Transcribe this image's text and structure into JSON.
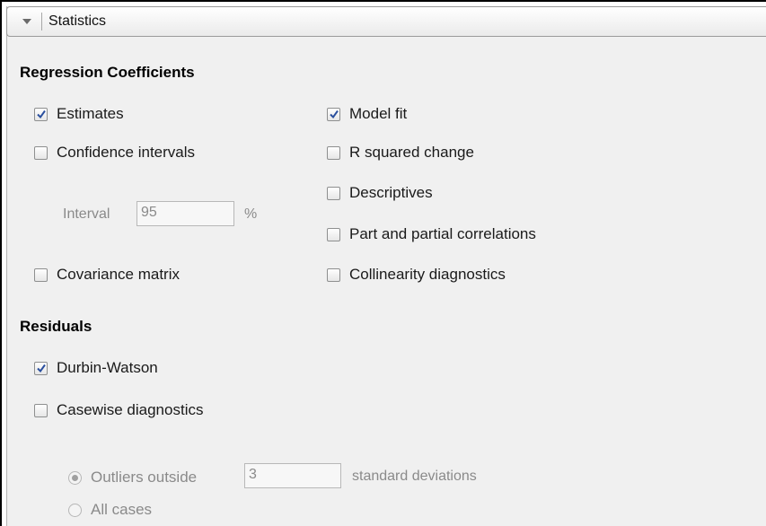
{
  "header": {
    "title": "Statistics"
  },
  "regression": {
    "title": "Regression Coefficients",
    "estimates": {
      "label": "Estimates",
      "checked": true
    },
    "confidence_intervals": {
      "label": "Confidence intervals",
      "checked": false
    },
    "interval": {
      "label": "Interval",
      "value": "95",
      "unit": "%"
    },
    "covariance_matrix": {
      "label": "Covariance matrix",
      "checked": false
    },
    "model_fit": {
      "label": "Model fit",
      "checked": true
    },
    "r_squared_change": {
      "label": "R squared change",
      "checked": false
    },
    "descriptives": {
      "label": "Descriptives",
      "checked": false
    },
    "part_partial": {
      "label": "Part and partial correlations",
      "checked": false
    },
    "collinearity": {
      "label": "Collinearity diagnostics",
      "checked": false
    }
  },
  "residuals": {
    "title": "Residuals",
    "durbin_watson": {
      "label": "Durbin-Watson",
      "checked": true
    },
    "casewise": {
      "label": "Casewise diagnostics",
      "checked": false
    },
    "outliers": {
      "label": "Outliers outside",
      "value": "3",
      "suffix": "standard deviations",
      "selected": true
    },
    "all_cases": {
      "label": "All cases",
      "selected": false
    }
  },
  "colors": {
    "check": "#2a4f9e",
    "disabled_text": "#8a8a8a",
    "panel_bg": "#f0f0f0"
  }
}
